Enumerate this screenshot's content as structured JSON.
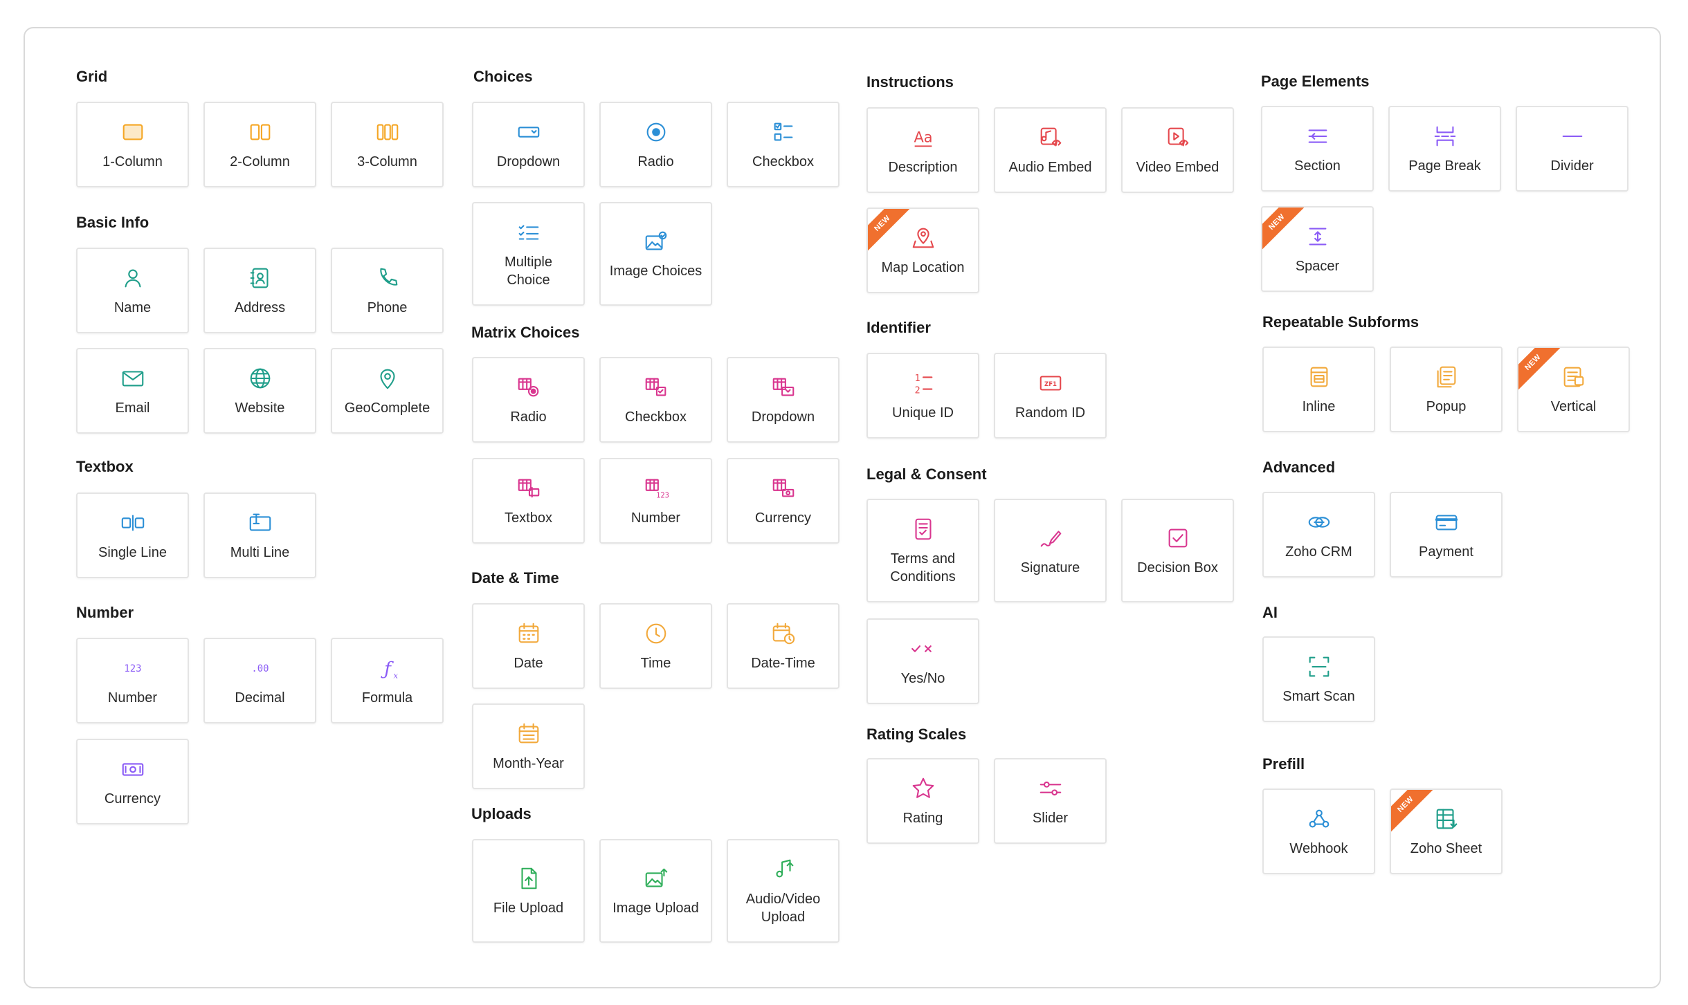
{
  "colors": {
    "orange": "#f5a623",
    "teal": "#1f9e8a",
    "purple": "#8b5cf6",
    "blue": "#2b8fd6",
    "magenta": "#d9368f",
    "red": "#e5484d",
    "amber": "#f2a93b",
    "green": "#2fae5a",
    "badge": "#f0702e"
  },
  "badge_label": "NEW",
  "sections": [
    {
      "id": "grid",
      "title": "Grid",
      "items": [
        {
          "label": "1-Column",
          "icon": "one-column-icon",
          "color": "#f5a623"
        },
        {
          "label": "2-Column",
          "icon": "two-column-icon",
          "color": "#f5a623"
        },
        {
          "label": "3-Column",
          "icon": "three-column-icon",
          "color": "#f5a623"
        }
      ]
    },
    {
      "id": "basic",
      "title": "Basic Info",
      "items": [
        {
          "label": "Name",
          "icon": "person-icon",
          "color": "#1f9e8a"
        },
        {
          "label": "Address",
          "icon": "address-book-icon",
          "color": "#1f9e8a"
        },
        {
          "label": "Phone",
          "icon": "phone-icon",
          "color": "#1f9e8a"
        },
        {
          "label": "Email",
          "icon": "envelope-icon",
          "color": "#1f9e8a"
        },
        {
          "label": "Website",
          "icon": "globe-icon",
          "color": "#1f9e8a"
        },
        {
          "label": "GeoComplete",
          "icon": "map-pin-icon",
          "color": "#1f9e8a"
        }
      ]
    },
    {
      "id": "textbox",
      "title": "Textbox",
      "items": [
        {
          "label": "Single Line",
          "icon": "single-line-icon",
          "color": "#2b8fd6"
        },
        {
          "label": "Multi Line",
          "icon": "multi-line-icon",
          "color": "#2b8fd6"
        }
      ]
    },
    {
      "id": "number",
      "title": "Number",
      "items": [
        {
          "label": "Number",
          "icon": "number-icon",
          "color": "#8b5cf6"
        },
        {
          "label": "Decimal",
          "icon": "decimal-icon",
          "color": "#8b5cf6"
        },
        {
          "label": "Formula",
          "icon": "formula-icon",
          "color": "#8b5cf6"
        },
        {
          "label": "Currency",
          "icon": "currency-icon",
          "color": "#8b5cf6"
        }
      ]
    },
    {
      "id": "choices",
      "title": "Choices",
      "items": [
        {
          "label": "Dropdown",
          "icon": "dropdown-icon",
          "color": "#2b8fd6"
        },
        {
          "label": "Radio",
          "icon": "radio-icon",
          "color": "#2b8fd6"
        },
        {
          "label": "Checkbox",
          "icon": "checkbox-list-icon",
          "color": "#2b8fd6"
        },
        {
          "label": "Multiple\nChoice",
          "icon": "multiple-choice-icon",
          "color": "#2b8fd6"
        },
        {
          "label": "Image Choices",
          "icon": "image-choices-icon",
          "color": "#2b8fd6"
        }
      ]
    },
    {
      "id": "matrix",
      "title": "Matrix Choices",
      "items": [
        {
          "label": "Radio",
          "icon": "matrix-radio-icon",
          "color": "#d9368f"
        },
        {
          "label": "Checkbox",
          "icon": "matrix-checkbox-icon",
          "color": "#d9368f"
        },
        {
          "label": "Dropdown",
          "icon": "matrix-dropdown-icon",
          "color": "#d9368f"
        },
        {
          "label": "Textbox",
          "icon": "matrix-textbox-icon",
          "color": "#d9368f"
        },
        {
          "label": "Number",
          "icon": "matrix-number-icon",
          "color": "#d9368f"
        },
        {
          "label": "Currency",
          "icon": "matrix-currency-icon",
          "color": "#d9368f"
        }
      ]
    },
    {
      "id": "datetime",
      "title": "Date & Time",
      "items": [
        {
          "label": "Date",
          "icon": "calendar-icon",
          "color": "#f2a93b"
        },
        {
          "label": "Time",
          "icon": "clock-icon",
          "color": "#f2a93b"
        },
        {
          "label": "Date-Time",
          "icon": "calendar-clock-icon",
          "color": "#f2a93b"
        },
        {
          "label": "Month-Year",
          "icon": "month-year-icon",
          "color": "#f2a93b"
        }
      ]
    },
    {
      "id": "uploads",
      "title": "Uploads",
      "items": [
        {
          "label": "File Upload",
          "icon": "file-upload-icon",
          "color": "#2fae5a"
        },
        {
          "label": "Image Upload",
          "icon": "image-upload-icon",
          "color": "#2fae5a"
        },
        {
          "label": "Audio/Video\nUpload",
          "icon": "media-upload-icon",
          "color": "#2fae5a"
        }
      ]
    },
    {
      "id": "instructions",
      "title": "Instructions",
      "items": [
        {
          "label": "Description",
          "icon": "text-aa-icon",
          "color": "#e5484d"
        },
        {
          "label": "Audio Embed",
          "icon": "audio-embed-icon",
          "color": "#e5484d"
        },
        {
          "label": "Video Embed",
          "icon": "video-embed-icon",
          "color": "#e5484d"
        },
        {
          "label": "Map Location",
          "icon": "map-location-icon",
          "color": "#e5484d",
          "new": true
        }
      ]
    },
    {
      "id": "identifier",
      "title": "Identifier",
      "items": [
        {
          "label": "Unique ID",
          "icon": "unique-id-icon",
          "color": "#e5484d"
        },
        {
          "label": "Random ID",
          "icon": "random-id-icon",
          "color": "#e5484d",
          "tag": "ZF1"
        }
      ]
    },
    {
      "id": "legal",
      "title": "Legal & Consent",
      "items": [
        {
          "label": "Terms and\nConditions",
          "icon": "terms-icon",
          "color": "#d9368f"
        },
        {
          "label": "Signature",
          "icon": "signature-icon",
          "color": "#d9368f"
        },
        {
          "label": "Decision Box",
          "icon": "decision-box-icon",
          "color": "#d9368f"
        },
        {
          "label": "Yes/No",
          "icon": "yes-no-icon",
          "color": "#d9368f"
        }
      ]
    },
    {
      "id": "rating",
      "title": "Rating Scales",
      "items": [
        {
          "label": "Rating",
          "icon": "star-icon",
          "color": "#d9368f"
        },
        {
          "label": "Slider",
          "icon": "slider-icon",
          "color": "#d9368f"
        }
      ]
    },
    {
      "id": "page",
      "title": "Page Elements",
      "items": [
        {
          "label": "Section",
          "icon": "section-icon",
          "color": "#8b5cf6"
        },
        {
          "label": "Page Break",
          "icon": "page-break-icon",
          "color": "#8b5cf6"
        },
        {
          "label": "Divider",
          "icon": "divider-icon",
          "color": "#8b5cf6"
        },
        {
          "label": "Spacer",
          "icon": "spacer-icon",
          "color": "#8b5cf6",
          "new": true
        }
      ]
    },
    {
      "id": "subforms",
      "title": "Repeatable Subforms",
      "items": [
        {
          "label": "Inline",
          "icon": "inline-subform-icon",
          "color": "#f2a93b"
        },
        {
          "label": "Popup",
          "icon": "popup-subform-icon",
          "color": "#f2a93b"
        },
        {
          "label": "Vertical",
          "icon": "vertical-subform-icon",
          "color": "#f2a93b",
          "new": true
        }
      ]
    },
    {
      "id": "advanced",
      "title": "Advanced",
      "items": [
        {
          "label": "Zoho CRM",
          "icon": "crm-link-icon",
          "color": "#2b8fd6"
        },
        {
          "label": "Payment",
          "icon": "credit-card-icon",
          "color": "#2b8fd6"
        }
      ]
    },
    {
      "id": "ai",
      "title": "AI",
      "items": [
        {
          "label": "Smart Scan",
          "icon": "scan-icon",
          "color": "#1f9e8a"
        }
      ]
    },
    {
      "id": "prefill",
      "title": "Prefill",
      "items": [
        {
          "label": "Webhook",
          "icon": "webhook-icon",
          "color": "#2b8fd6"
        },
        {
          "label": "Zoho Sheet",
          "icon": "sheet-icon",
          "color": "#1f9e8a",
          "new": true
        }
      ]
    }
  ]
}
